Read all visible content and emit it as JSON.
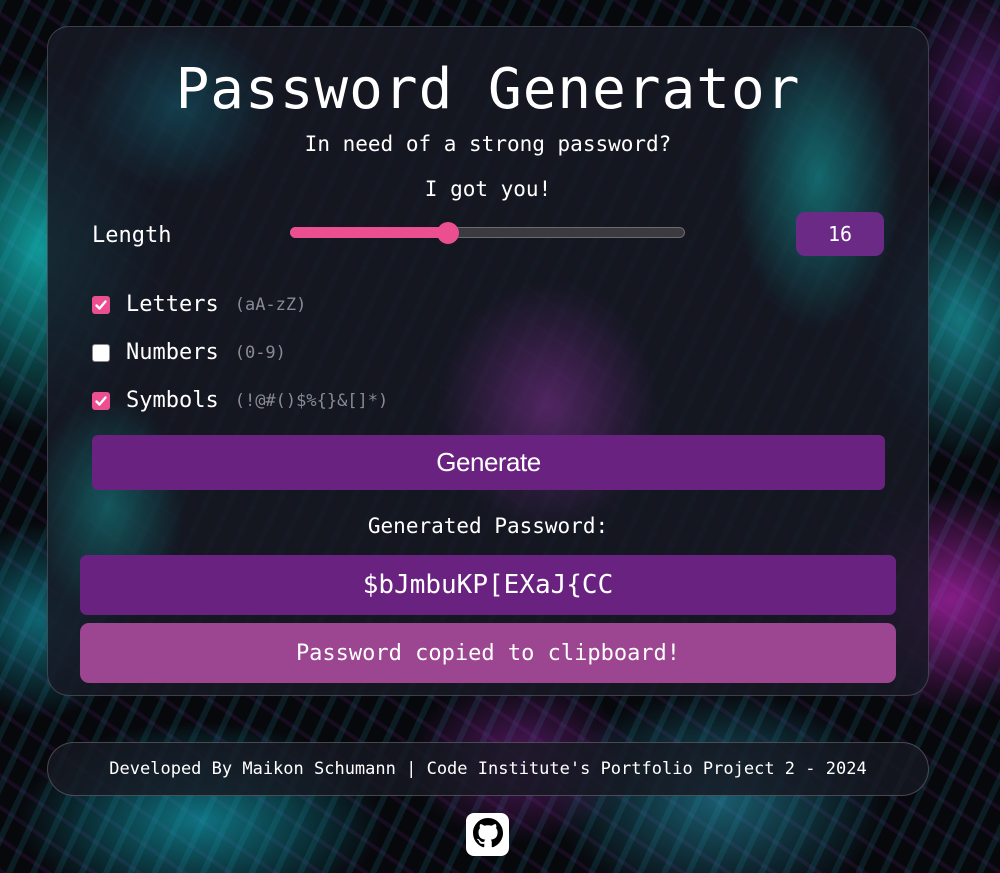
{
  "app": {
    "title": "Password Generator",
    "subtitle_line1": "In need of a strong password?",
    "subtitle_line2": "I got you!"
  },
  "length": {
    "label": "Length",
    "value": "16",
    "slider_fraction": 0.4
  },
  "options": [
    {
      "label": "Letters",
      "hint": "(aA-zZ)",
      "checked": true
    },
    {
      "label": "Numbers",
      "hint": "(0-9)",
      "checked": false
    },
    {
      "label": "Symbols",
      "hint": "(!@#()$%{}&[]*)",
      "checked": true
    }
  ],
  "generate_button": "Generate",
  "generated_label": "Generated Password:",
  "password": "$bJmbuKP[EXaJ{CC",
  "copied_message": "Password copied to clipboard!",
  "footer": "Developed By Maikon Schumann | Code Institute's Portfolio Project 2 - 2024",
  "icons": {
    "github": "github-icon",
    "check": "check-icon"
  },
  "colors": {
    "accent_pink": "#ec4f90",
    "button_purple": "#6a2280",
    "toast_magenta": "#9c4590"
  }
}
